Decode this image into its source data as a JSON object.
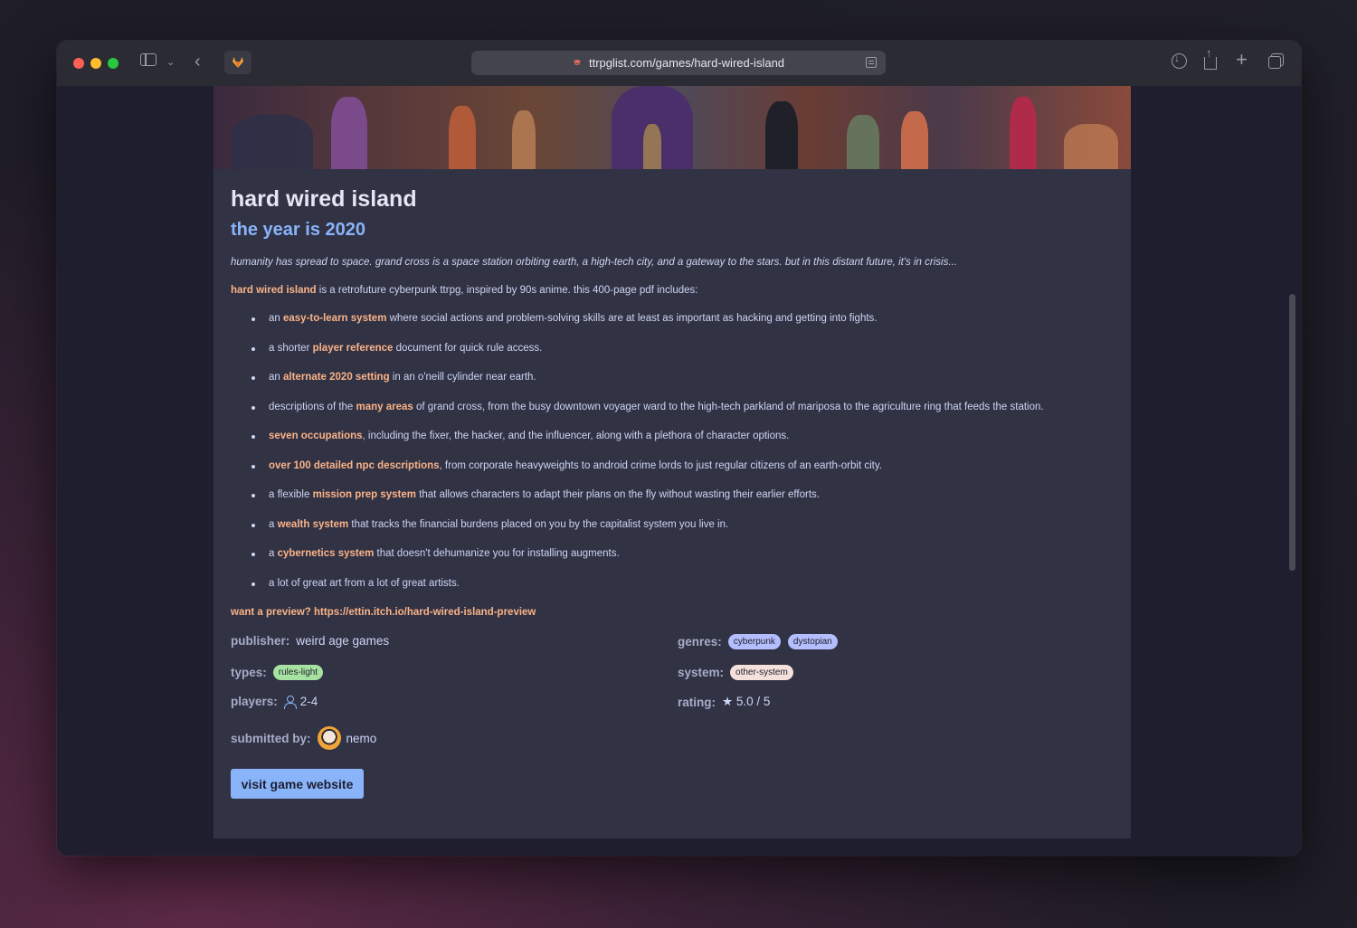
{
  "browser": {
    "url": "ttrpglist.com/games/hard-wired-island",
    "colors": {
      "close": "#fe5f57",
      "minimize": "#febc2e",
      "zoom": "#28c840"
    }
  },
  "game": {
    "title": "hard wired island",
    "subtitle": "the year is 2020",
    "tagline": "humanity has spread to space. grand cross is a space station orbiting earth, a high-tech city, and a gateway to the stars. but in this distant future, it's in crisis...",
    "intro_highlight": "hard wired island",
    "intro_rest": " is a retrofuture cyberpunk ttrpg, inspired by 90s anime. this 400-page pdf includes:",
    "features": [
      {
        "pre": "an ",
        "hl": "easy-to-learn system",
        "post": " where social actions and problem-solving skills are at least as important as hacking and getting into fights."
      },
      {
        "pre": "a shorter ",
        "hl": "player reference",
        "post": " document for quick rule access."
      },
      {
        "pre": "an ",
        "hl": "alternate 2020 setting",
        "post": " in an o'neill cylinder near earth."
      },
      {
        "pre": "descriptions of the ",
        "hl": "many areas",
        "post": " of grand cross, from the busy downtown voyager ward to the high-tech parkland of mariposa to the agriculture ring that feeds the station."
      },
      {
        "pre": "",
        "hl": "seven occupations",
        "post": ", including the fixer, the hacker, and the influencer, along with a plethora of character options."
      },
      {
        "pre": "",
        "hl": "over 100 detailed npc descriptions",
        "post": ", from corporate heavyweights to android crime lords to just regular citizens of an earth-orbit city."
      },
      {
        "pre": "a flexible ",
        "hl": "mission prep system",
        "post": " that allows characters to adapt their plans on the fly without wasting their earlier efforts."
      },
      {
        "pre": "a ",
        "hl": "wealth system",
        "post": " that tracks the financial burdens placed on you by the capitalist system you live in."
      },
      {
        "pre": "a ",
        "hl": "cybernetics system",
        "post": " that doesn't dehumanize you for installing augments."
      },
      {
        "pre": "a lot of great art from a lot of great artists.",
        "hl": "",
        "post": ""
      }
    ],
    "preview": "want a preview? https://ettin.itch.io/hard-wired-island-preview",
    "publisher_label": "publisher:",
    "publisher": "weird age games",
    "genres_label": "genres:",
    "genres": [
      "cyberpunk",
      "dystopian"
    ],
    "types_label": "types:",
    "types": [
      "rules-light"
    ],
    "system_label": "system:",
    "system": "other-system",
    "players_label": "players:",
    "players": "2-4",
    "rating_label": "rating:",
    "rating": "★ 5.0 / 5",
    "submitted_label": "submitted by:",
    "submitted_by": "nemo",
    "visit_button": "visit game website",
    "accent": "#fab387",
    "link_blue": "#89b4fa"
  }
}
